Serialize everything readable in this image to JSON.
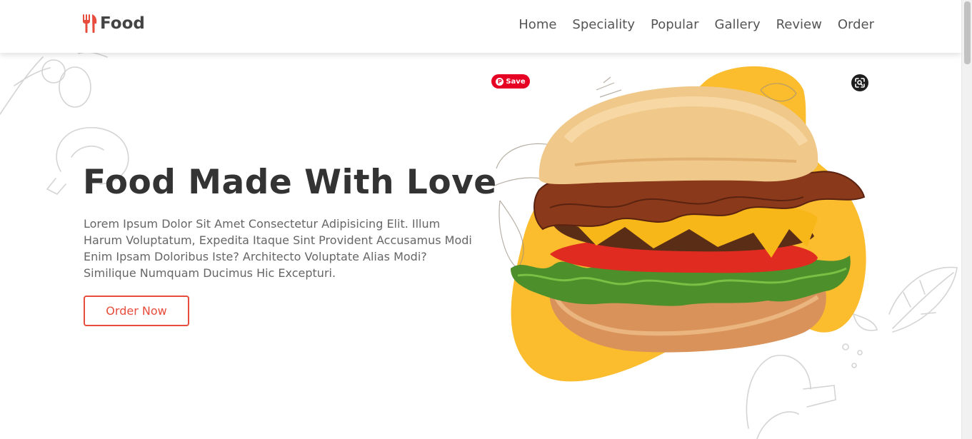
{
  "header": {
    "logo_text": "Food",
    "nav": [
      "Home",
      "Speciality",
      "Popular",
      "Gallery",
      "Review",
      "Order"
    ]
  },
  "hero": {
    "title": "Food Made With Love",
    "description": "Lorem Ipsum Dolor Sit Amet Consectetur Adipisicing Elit. Illum Harum Voluptatum, Expedita Itaque Sint Provident Accusamus Modi Enim Ipsam Doloribus Iste? Architecto Voluptate Alias Modi? Similique Numquam Ducimus Hic Excepturi.",
    "button_label": "Order Now"
  },
  "overlay": {
    "pin_save_label": "Save",
    "pin_icon": "pinterest-icon",
    "lens_icon": "visual-search-icon"
  },
  "colors": {
    "accent": "#e74c3c",
    "blob": "#fbbc2e",
    "pinterest": "#e60023",
    "text_dark": "#333333",
    "text_muted": "#666666"
  }
}
